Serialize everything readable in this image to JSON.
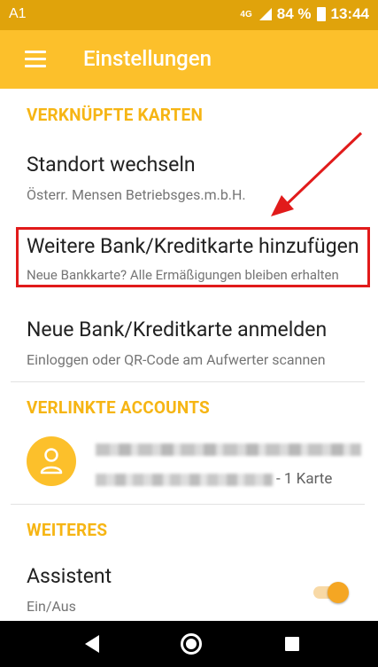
{
  "status_bar": {
    "carrier": "A1",
    "network": "4G",
    "battery": "84 %",
    "time": "13:44"
  },
  "app_bar": {
    "title": "Einstellungen"
  },
  "sections": {
    "linked_cards": {
      "header": "VERKNÜPFTE KARTEN",
      "change_location_title": "Standort wechseln",
      "change_location_sub": "Österr. Mensen Betriebsges.m.b.H.",
      "add_card_title": "Weitere Bank/Kreditkarte hinzufügen",
      "add_card_sub": "Neue Bankkarte? Alle Ermäßigungen bleiben erhalten",
      "register_card_title": "Neue Bank/Kreditkarte anmelden",
      "register_card_sub": "Einloggen oder QR-Code am Aufwerter scannen"
    },
    "linked_accounts": {
      "header": "VERLINKTE ACCOUNTS",
      "card_count": "- 1 Karte"
    },
    "more": {
      "header": "WEITERES",
      "assistant_title": "Assistent",
      "assistant_sub": "Ein/Aus",
      "assistant_enabled": true
    }
  },
  "colors": {
    "status_bar": "#e0a30b",
    "app_bar": "#fcc02b",
    "accent": "#f6b514",
    "annotation_red": "#e11b1b"
  }
}
